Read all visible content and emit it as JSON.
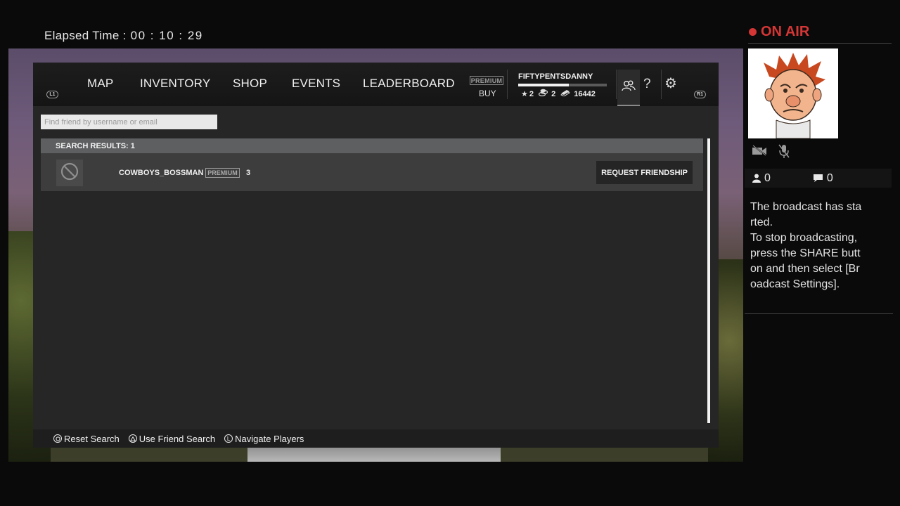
{
  "stream": {
    "elapsed_label": "Elapsed Time :",
    "elapsed_value": "00 : 10 : 29",
    "on_air": "ON AIR",
    "viewers": "0",
    "comments": "0",
    "message_lines": [
      "The broadcast has started.",
      "To stop broadcasting, press the SHARE button and then select [Broadcast Settings]."
    ]
  },
  "topbar": {
    "left_bumper": "L1",
    "right_bumper": "R1",
    "nav": [
      "MAP",
      "INVENTORY",
      "SHOP",
      "EVENTS",
      "LEADERBOARD"
    ],
    "premium_badge": "PREMIUM",
    "buy_label": "BUY",
    "username": "FIFTYPENTSDANNY",
    "xp_progress": 0.57,
    "stats": {
      "stars": "2",
      "coins": "2",
      "cash": "16442"
    }
  },
  "search": {
    "placeholder": "Find friend by username or email",
    "results_label": "SEARCH RESULTS: 1"
  },
  "results": [
    {
      "name": "COWBOYS_BOSSMAN",
      "badge": "PREMIUM",
      "level": "3",
      "action": "REQUEST FRIENDSHIP"
    }
  ],
  "footer": {
    "hints": [
      {
        "glyph": "circle",
        "label": "Reset Search"
      },
      {
        "glyph": "triangle",
        "label": "Use Friend Search"
      },
      {
        "glyph": "L",
        "label": "Navigate Players"
      }
    ]
  },
  "colors": {
    "on_air_red": "#d43636",
    "panel_bg": "#262626",
    "topbar_bg": "#1a1a1a"
  }
}
